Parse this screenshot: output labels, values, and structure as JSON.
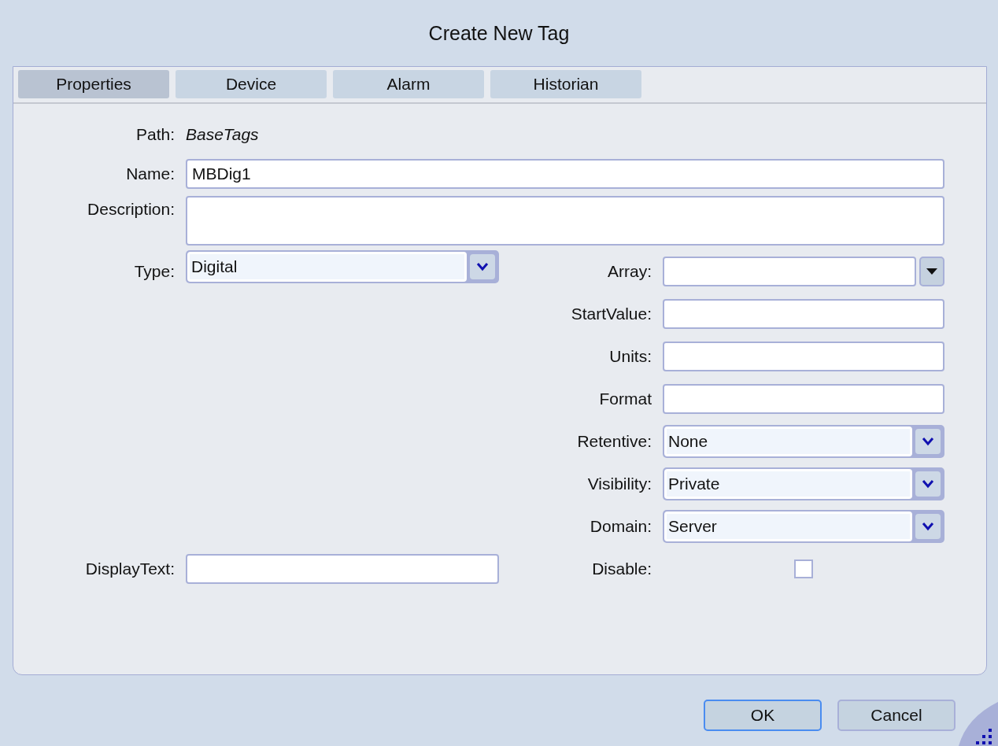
{
  "window": {
    "title": "Create New Tag"
  },
  "tabs": [
    {
      "label": "Properties",
      "selected": true
    },
    {
      "label": "Device",
      "selected": false
    },
    {
      "label": "Alarm",
      "selected": false
    },
    {
      "label": "Historian",
      "selected": false
    }
  ],
  "path": {
    "label": "Path:",
    "value": "BaseTags"
  },
  "name": {
    "label": "Name:",
    "value": "MBDig1"
  },
  "description": {
    "label": "Description:"
  },
  "type": {
    "label": "Type:",
    "value": "Digital"
  },
  "display_text": {
    "label": "DisplayText:"
  },
  "right_fields": [
    {
      "label": "Array:",
      "kind": "combo"
    },
    {
      "label": "StartValue:",
      "kind": "text"
    },
    {
      "label": "Units:",
      "kind": "text"
    },
    {
      "label": "Format",
      "kind": "text"
    },
    {
      "label": "Retentive:",
      "kind": "dropdown",
      "value": "None"
    },
    {
      "label": "Visibility:",
      "kind": "dropdown",
      "value": "Private"
    },
    {
      "label": "Domain:",
      "kind": "dropdown",
      "value": "Server"
    },
    {
      "label": "Disable:",
      "kind": "checkbox",
      "checked": false
    }
  ],
  "buttons": [
    {
      "label": "OK",
      "focused": true
    },
    {
      "label": "Cancel",
      "focused": false
    }
  ]
}
